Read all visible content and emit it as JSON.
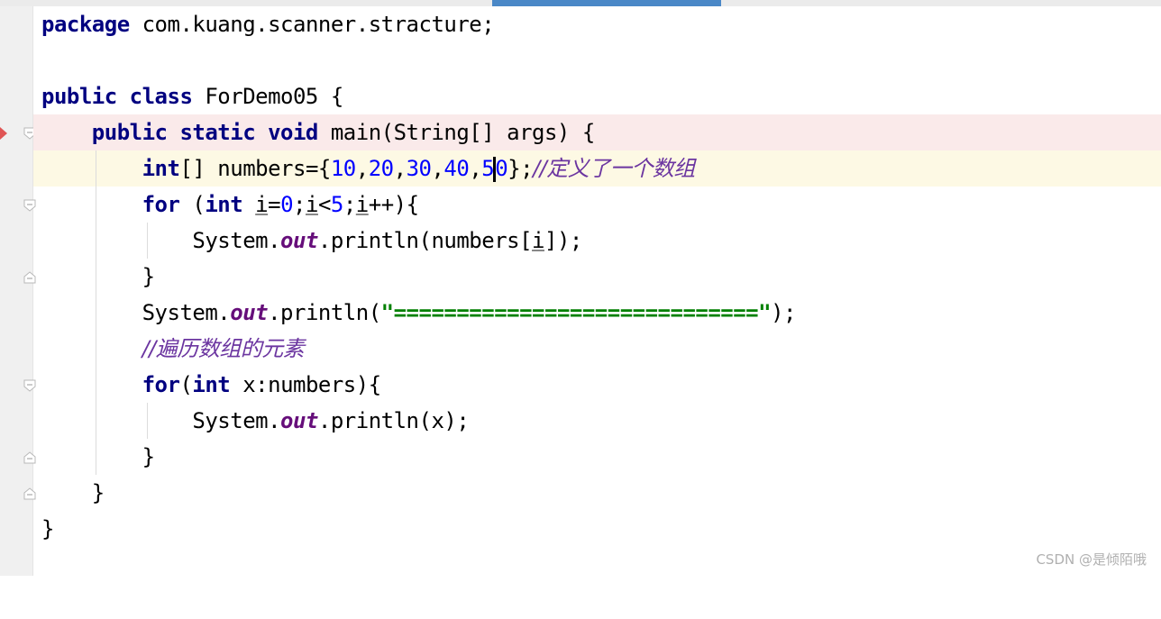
{
  "editor": {
    "package_kw": "package",
    "package_name": " com.kuang.scanner.stracture;",
    "class_kw": "public class",
    "class_name": " ForDemo05 {",
    "main_kw": "public static void",
    "main_sig": " main(String[] args) {",
    "line_int_kw": "int",
    "line_numbers_a": "[] numbers={",
    "nums": [
      "10",
      "20",
      "30",
      "40",
      "5",
      "0"
    ],
    "line_numbers_b": "};",
    "comment_array": "//定义了一个数组",
    "for_kw": "for",
    "for_paren": " (",
    "for_int": "int",
    "for_init_a": " ",
    "var_i": "i",
    "for_init_b": "=",
    "zero": "0",
    "semi": ";",
    "lt": "<",
    "five": "5",
    "inc": "++){",
    "system": "System.",
    "out": "out",
    "println_numbers_a": ".println(numbers[",
    "println_numbers_b": "]);",
    "close_brace": "}",
    "println_str_a": ".println(",
    "equals_string": "\"=============================\"",
    "println_str_b": ");",
    "comment_traverse": "//遍历数组的元素",
    "for2_kw": "for",
    "for2_paren": "(",
    "for2_int": "int",
    "for2_rest": " x:numbers){",
    "println_x": ".println(x);"
  },
  "watermark": "CSDN @是倾陌哦",
  "colors": {
    "keyword": "#000080",
    "number": "#0000ff",
    "string": "#008000",
    "comment": "#6b35a0",
    "field": "#660e7a",
    "breakpoint_line": "#faeaea",
    "current_line": "#fdf9e4"
  },
  "icons": [
    "breakpoint-marker-icon",
    "fold-marker-icon"
  ]
}
